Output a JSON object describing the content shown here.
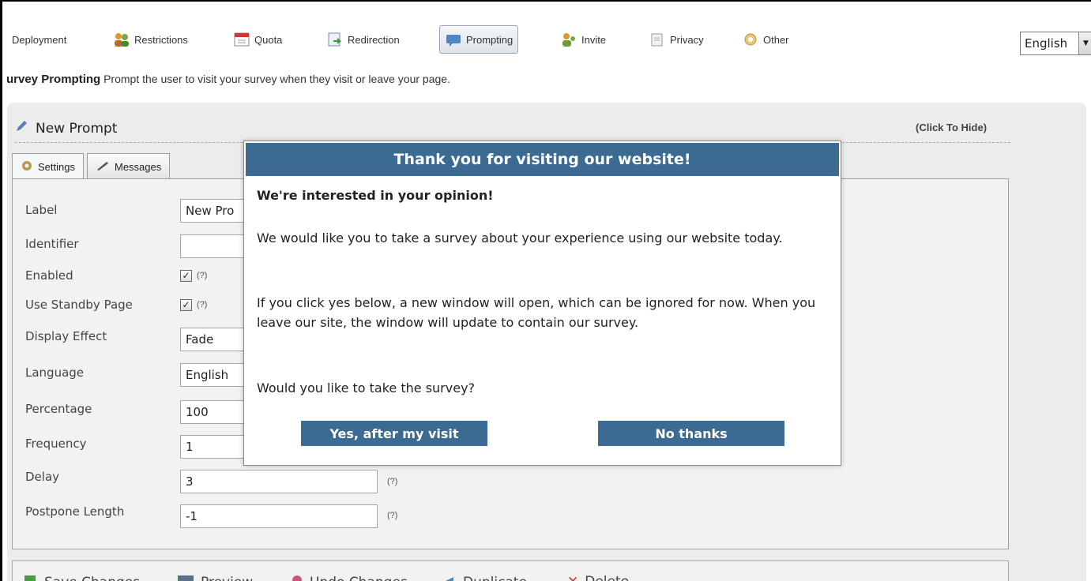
{
  "toolbar": {
    "items": [
      {
        "label": "Deployment",
        "icon": "deployment-icon"
      },
      {
        "label": "Restrictions",
        "icon": "users-icon"
      },
      {
        "label": "Quota",
        "icon": "calendar-icon"
      },
      {
        "label": "Redirection",
        "icon": "redirect-icon"
      },
      {
        "label": "Prompting",
        "icon": "prompt-icon"
      },
      {
        "label": "Invite",
        "icon": "invite-icon"
      },
      {
        "label": "Privacy",
        "icon": "privacy-icon"
      },
      {
        "label": "Other",
        "icon": "other-icon"
      }
    ],
    "active": "Prompting",
    "language": "English"
  },
  "subtitle": {
    "title": "urvey Prompting",
    "text": "Prompt the user to visit your survey when they visit or leave your page."
  },
  "panel": {
    "title": "New Prompt",
    "hide_link": "(Click To Hide)",
    "tabs": [
      {
        "label": "Settings"
      },
      {
        "label": "Messages"
      }
    ]
  },
  "form": {
    "label": {
      "name": "Label",
      "value": "New Pro"
    },
    "identifier": {
      "name": "Identifier",
      "value": ""
    },
    "enabled": {
      "name": "Enabled",
      "help": "(?)"
    },
    "standby": {
      "name": "Use Standby Page",
      "help": "(?)"
    },
    "display_effect": {
      "name": "Display Effect",
      "value": "Fade"
    },
    "language": {
      "name": "Language",
      "value": "English"
    },
    "percentage": {
      "name": "Percentage",
      "value": "100"
    },
    "frequency": {
      "name": "Frequency",
      "value": "1"
    },
    "delay": {
      "name": "Delay",
      "value": "3",
      "help": "(?)"
    },
    "postpone": {
      "name": "Postpone Length",
      "value": "-1",
      "help": "(?)"
    }
  },
  "bottom_bar": {
    "save": "Save Changes",
    "preview": "Preview",
    "undo": "Undo Changes",
    "duplicate": "Duplicate",
    "delete": "Delete"
  },
  "modal": {
    "title": "Thank you for visiting our website!",
    "heading": "We're interested in your opinion!",
    "para1": "We would like you to take a survey about your experience using our website today.",
    "para2": "If you click yes below, a new window will open, which can be ignored for now. When you leave our site, the window will update to contain our survey.",
    "question": "Would you like to take the survey?",
    "yes_label": "Yes, after my visit",
    "no_label": "No thanks"
  },
  "colors": {
    "modal_header": "#3b6a93",
    "panel_bg": "#ececec"
  }
}
